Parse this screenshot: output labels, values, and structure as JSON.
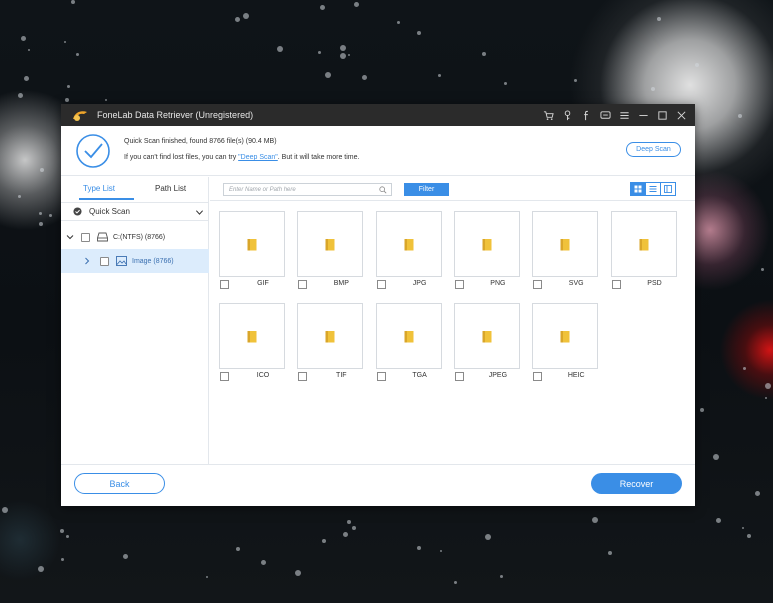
{
  "window": {
    "title": "FoneLab Data Retriever (Unregistered)",
    "title_icons": [
      "cart-icon",
      "key-icon",
      "facebook-icon",
      "chat-icon",
      "menu-icon",
      "minimize-icon",
      "maximize-icon",
      "close-icon"
    ]
  },
  "status": {
    "line1": "Quick Scan finished, found 8766 file(s) (90.4 MB)",
    "line2_before": "If you can't find lost files, you can try ",
    "line2_link": "\"Deep Scan\"",
    "line2_after": ". But it will take more time.",
    "deep_scan_label": "Deep Scan"
  },
  "sidebar": {
    "tabs": [
      {
        "label": "Type List",
        "active": true
      },
      {
        "label": "Path List",
        "active": false
      }
    ],
    "quick_scan_label": "Quick Scan",
    "tree": [
      {
        "label": "C:(NTFS) (8766)",
        "expanded": true,
        "selected": false
      },
      {
        "label": "Image (8766)",
        "expanded": false,
        "selected": true
      }
    ]
  },
  "toolbar": {
    "search_placeholder": "Enter Name or Path here",
    "filter_label": "Filter",
    "view_modes": [
      "grid-view-icon",
      "list-view-icon",
      "detail-view-icon"
    ],
    "active_view": "grid-view-icon"
  },
  "grid": {
    "items": [
      {
        "label": "GIF"
      },
      {
        "label": "BMP"
      },
      {
        "label": "JPG"
      },
      {
        "label": "PNG"
      },
      {
        "label": "SVG"
      },
      {
        "label": "PSD"
      },
      {
        "label": "ICO"
      },
      {
        "label": "TIF"
      },
      {
        "label": "TGA"
      },
      {
        "label": "JPEG"
      },
      {
        "label": "HEIC"
      }
    ]
  },
  "footer": {
    "back_label": "Back",
    "recover_label": "Recover"
  },
  "colors": {
    "accent": "#3a8ee6",
    "titlebar": "#2b2b2b",
    "selected_row": "#dcecfc",
    "folder": "#f0c23a"
  }
}
